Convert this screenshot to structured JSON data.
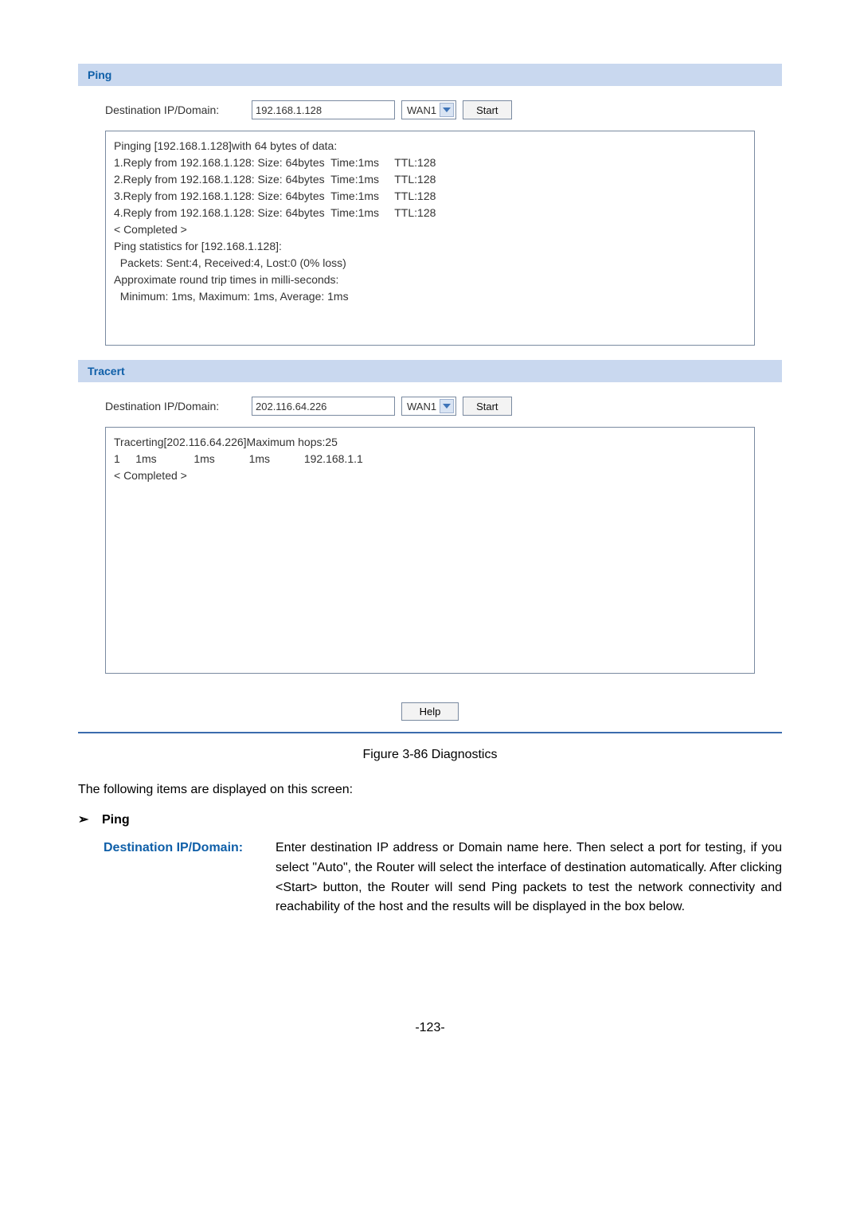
{
  "ping": {
    "header": "Ping",
    "label": "Destination IP/Domain:",
    "input_value": "192.168.1.128",
    "select_value": "WAN1",
    "start_label": "Start",
    "output": "Pinging [192.168.1.128]with 64 bytes of data:\n1.Reply from 192.168.1.128: Size: 64bytes  Time:1ms     TTL:128\n2.Reply from 192.168.1.128: Size: 64bytes  Time:1ms     TTL:128\n3.Reply from 192.168.1.128: Size: 64bytes  Time:1ms     TTL:128\n4.Reply from 192.168.1.128: Size: 64bytes  Time:1ms     TTL:128\n< Completed >\nPing statistics for [192.168.1.128]:\n  Packets: Sent:4, Received:4, Lost:0 (0% loss)\nApproximate round trip times in milli-seconds:\n  Minimum: 1ms, Maximum: 1ms, Average: 1ms"
  },
  "tracert": {
    "header": "Tracert",
    "label": "Destination IP/Domain:",
    "input_value": "202.116.64.226",
    "select_value": "WAN1",
    "start_label": "Start",
    "output": "Tracerting[202.116.64.226]Maximum hops:25\n1     1ms            1ms           1ms           192.168.1.1\n< Completed >"
  },
  "help_label": "Help",
  "figure_caption": "Figure 3-86 Diagnostics",
  "intro_text": "The following items are displayed on this screen:",
  "bullet_label": "Ping",
  "term": {
    "label": "Destination IP/Domain:",
    "text": "Enter destination IP address or Domain name here. Then select a port for testing, if you select \"Auto\", the Router will select the interface of destination automatically. After clicking <Start> button, the Router will send Ping packets to test the network connectivity and reachability of the host and the results will be displayed in the box below."
  },
  "page_number": "-123-"
}
